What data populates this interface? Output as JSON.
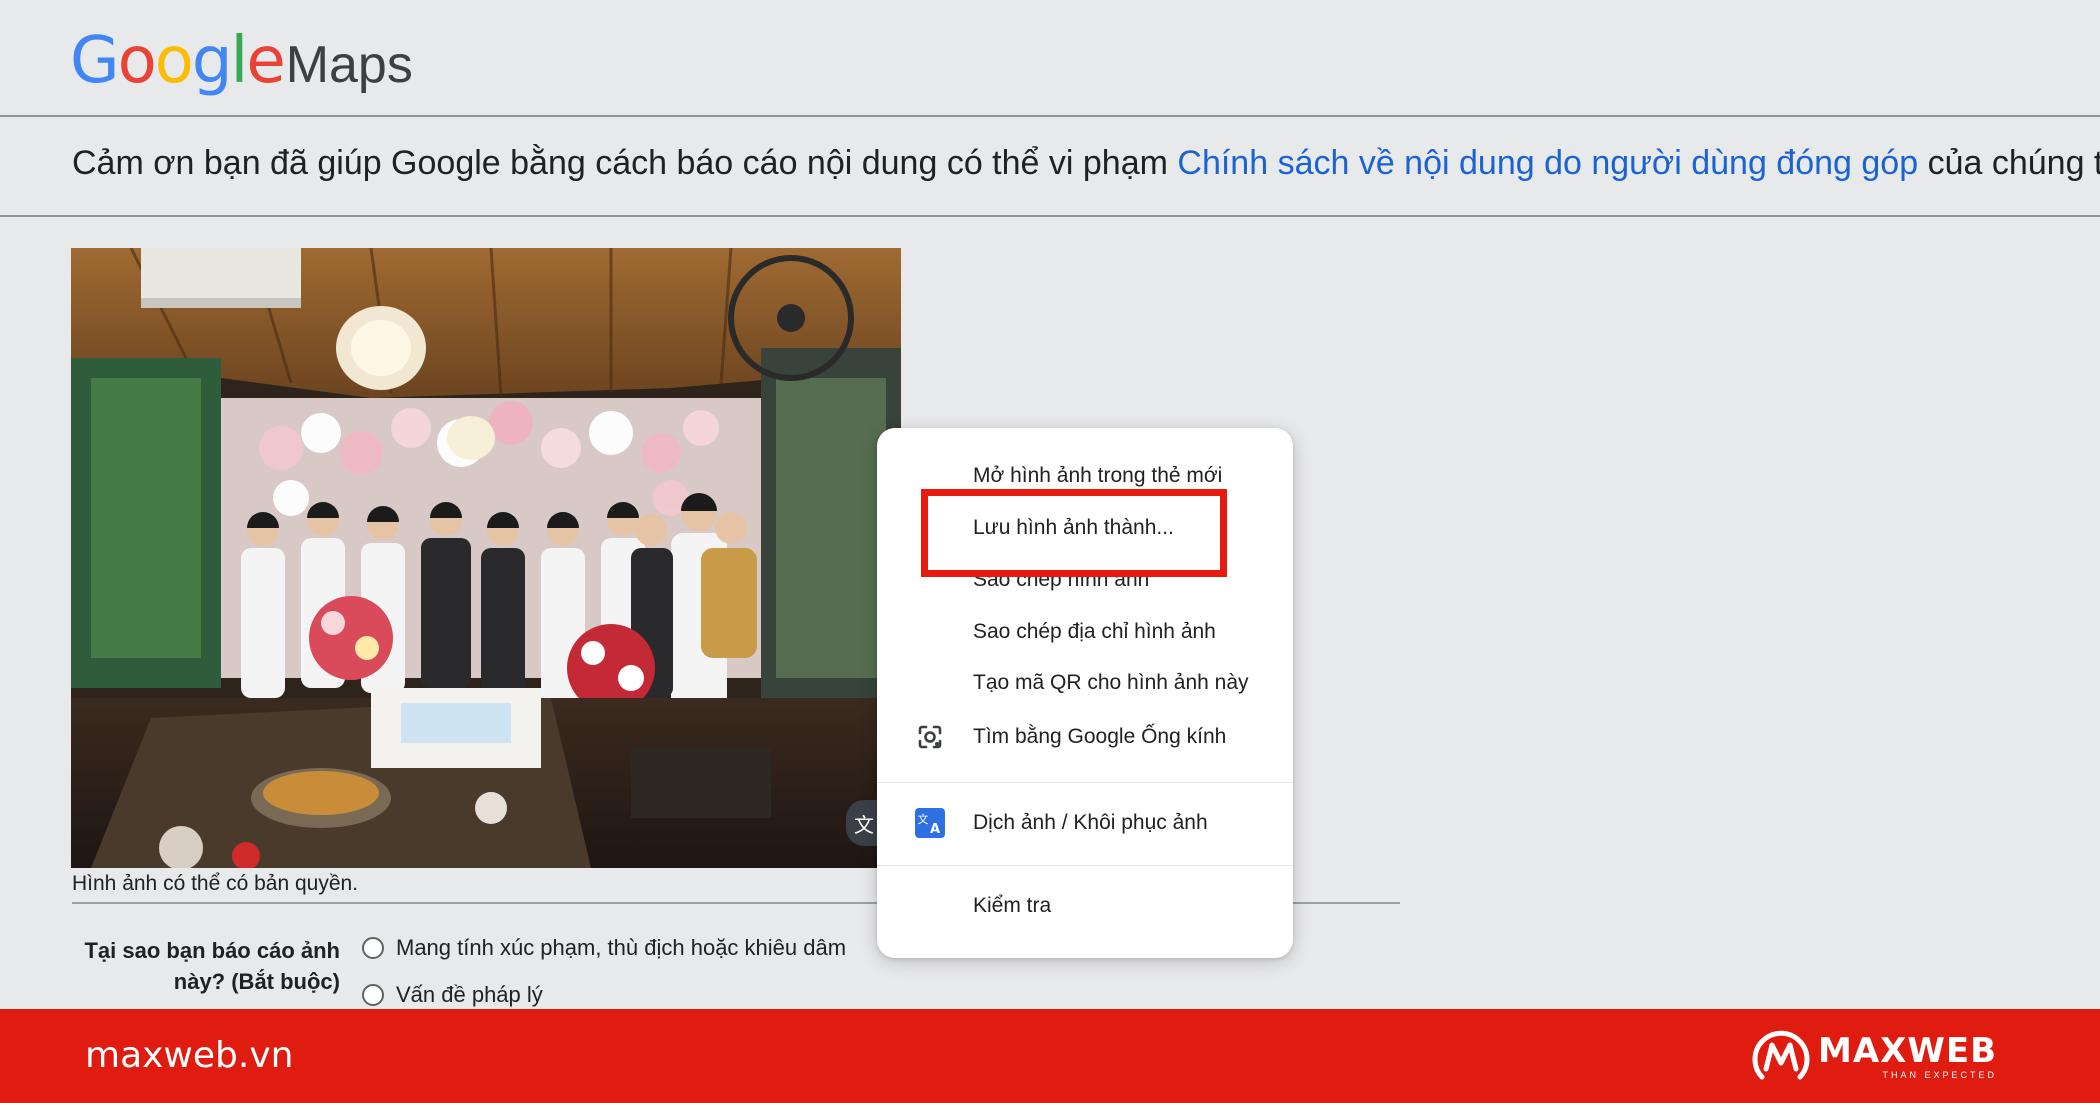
{
  "logo": {
    "google_letters": [
      {
        "char": "G",
        "color": "#4285F4"
      },
      {
        "char": "o",
        "color": "#EA4335"
      },
      {
        "char": "o",
        "color": "#FBBC05"
      },
      {
        "char": "g",
        "color": "#4285F4"
      },
      {
        "char": "l",
        "color": "#34A853"
      },
      {
        "char": "e",
        "color": "#EA4335"
      }
    ],
    "product": "Maps"
  },
  "notice": {
    "prefix": "Cảm ơn bạn đã giúp Google bằng cách báo cáo nội dung có thể vi phạm ",
    "link": "Chính sách về nội dung do người dùng đóng góp",
    "suffix": " của chúng tôi."
  },
  "photo": {
    "caption": "Hình ảnh có thể có bản quyền."
  },
  "form": {
    "question": "Tại sao bạn báo cáo ảnh này? (Bắt buộc)",
    "options": [
      "Mang tính xúc phạm, thù địch hoặc khiêu dâm",
      "Vấn đề pháp lý"
    ]
  },
  "context_menu": {
    "items": [
      {
        "label": "Mở hình ảnh trong thẻ mới",
        "icon": null
      },
      {
        "label": "Lưu hình ảnh thành...",
        "icon": null,
        "highlighted": true
      },
      {
        "label": "Sao chép hình ảnh",
        "icon": null
      },
      {
        "label": "Sao chép địa chỉ hình ảnh",
        "icon": null
      },
      {
        "label": "Tạo mã QR cho hình ảnh này",
        "icon": null
      },
      {
        "label": "Tìm bằng Google Ống kính",
        "icon": "google-lens-icon"
      },
      {
        "label": "Dịch ảnh / Khôi phục ảnh",
        "icon": "translate-icon"
      },
      {
        "label": "Kiểm tra",
        "icon": null
      }
    ]
  },
  "footer": {
    "website": "maxweb.vn",
    "brand": "MAXWEB",
    "tagline": "THAN EXPECTED"
  },
  "colors": {
    "link": "#1a63d2",
    "highlight_box": "#e8190f",
    "footer_bg": "#e01b0f",
    "page_bg": "#e8e9eb"
  }
}
